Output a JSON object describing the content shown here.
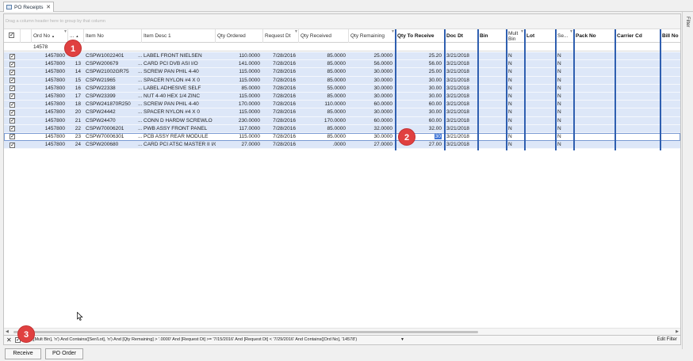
{
  "tab": {
    "label": "PO Receipts",
    "close": "✕"
  },
  "side_filter_label": "Filter",
  "group_prompt": "Drag a column header here to group by that column",
  "columns": {
    "ord_no": "Ord No",
    "line": "...",
    "item_no": "Item No",
    "item_desc": "Item Desc 1",
    "qty_ordered": "Qty Ordered",
    "request_dt": "Request Dt",
    "qty_received": "Qty Received",
    "qty_remaining": "Qty Remaining",
    "qty_to_receive": "Qty To Receive",
    "doc_dt": "Doc Dt",
    "bin": "Bin",
    "mult_bin": "Mult Bin",
    "lot": "Lot",
    "ser": "Se...",
    "pack_no": "Pack No",
    "carrier_cd": "Carrier Cd",
    "bill_no": "Bill No"
  },
  "filter_row": {
    "ord_no": "14578"
  },
  "ellipsis": "...",
  "rows": [
    {
      "checked": true,
      "ord_no": "1457800",
      "line": "",
      "item_no": "CSPW10022401",
      "item_desc": "LABEL FRONT NIELSEN",
      "qty_ordered": "110.0000",
      "request_dt": "7/28/2016",
      "qty_received": "85.0000",
      "qty_remaining": "25.0000",
      "qty_to_receive": "25.20",
      "doc_dt": "3/21/2018",
      "mult_bin": "N",
      "ser": "N"
    },
    {
      "checked": true,
      "ord_no": "1457800",
      "line": "13",
      "item_no": "CSPW200679",
      "item_desc": "CARD PCI DVB ASI I/O",
      "qty_ordered": "141.0000",
      "request_dt": "7/28/2016",
      "qty_received": "85.0000",
      "qty_remaining": "56.0000",
      "qty_to_receive": "56.00",
      "doc_dt": "3/21/2018",
      "mult_bin": "N",
      "ser": "N"
    },
    {
      "checked": true,
      "ord_no": "1457800",
      "line": "14",
      "item_no": "CSPW21002GR75",
      "item_desc": "SCREW PAN PHIL 4-40",
      "qty_ordered": "115.0000",
      "request_dt": "7/28/2016",
      "qty_received": "85.0000",
      "qty_remaining": "30.0000",
      "qty_to_receive": "25.00",
      "doc_dt": "3/21/2018",
      "mult_bin": "N",
      "ser": "N"
    },
    {
      "checked": true,
      "ord_no": "1457800",
      "line": "15",
      "item_no": "CSPW21965",
      "item_desc": "SPACER NYLON #4 X 0",
      "qty_ordered": "115.0000",
      "request_dt": "7/28/2016",
      "qty_received": "85.0000",
      "qty_remaining": "30.0000",
      "qty_to_receive": "30.00",
      "doc_dt": "3/21/2018",
      "mult_bin": "N",
      "ser": "N"
    },
    {
      "checked": true,
      "ord_no": "1457800",
      "line": "16",
      "item_no": "CSPW22338",
      "item_desc": "LABEL ADHESIVE SELF",
      "qty_ordered": "85.0000",
      "request_dt": "7/28/2016",
      "qty_received": "55.0000",
      "qty_remaining": "30.0000",
      "qty_to_receive": "30.00",
      "doc_dt": "3/21/2018",
      "mult_bin": "N",
      "ser": "N"
    },
    {
      "checked": true,
      "ord_no": "1457800",
      "line": "17",
      "item_no": "CSPW23399",
      "item_desc": "NUT 4-40 HEX 1/4 ZINC",
      "qty_ordered": "115.0000",
      "request_dt": "7/28/2016",
      "qty_received": "85.0000",
      "qty_remaining": "30.0000",
      "qty_to_receive": "30.00",
      "doc_dt": "3/21/2018",
      "mult_bin": "N",
      "ser": "N"
    },
    {
      "checked": true,
      "ord_no": "1457800",
      "line": "18",
      "item_no": "CSPW241870R250",
      "item_desc": "SCREW PAN PHIL 4-40",
      "qty_ordered": "170.0000",
      "request_dt": "7/28/2016",
      "qty_received": "110.0000",
      "qty_remaining": "60.0000",
      "qty_to_receive": "60.00",
      "doc_dt": "3/21/2018",
      "mult_bin": "N",
      "ser": "N"
    },
    {
      "checked": true,
      "ord_no": "1457800",
      "line": "20",
      "item_no": "CSPW24442",
      "item_desc": "SPACER NYLON #4 X 0",
      "qty_ordered": "115.0000",
      "request_dt": "7/28/2016",
      "qty_received": "85.0000",
      "qty_remaining": "30.0000",
      "qty_to_receive": "30.00",
      "doc_dt": "3/21/2018",
      "mult_bin": "N",
      "ser": "N"
    },
    {
      "checked": true,
      "ord_no": "1457800",
      "line": "21",
      "item_no": "CSPW24470",
      "item_desc": "CONN D HARDW SCREWLO",
      "qty_ordered": "230.0000",
      "request_dt": "7/28/2016",
      "qty_received": "170.0000",
      "qty_remaining": "60.0000",
      "qty_to_receive": "60.00",
      "doc_dt": "3/21/2018",
      "mult_bin": "N",
      "ser": "N"
    },
    {
      "checked": true,
      "ord_no": "1457800",
      "line": "22",
      "item_no": "CSPW70006201",
      "item_desc": "PWB ASSY FRONT PANEL",
      "qty_ordered": "117.0000",
      "request_dt": "7/28/2016",
      "qty_received": "85.0000",
      "qty_remaining": "32.0000",
      "qty_to_receive": "32.00",
      "doc_dt": "3/21/2018",
      "mult_bin": "N",
      "ser": "N"
    },
    {
      "checked": true,
      "ord_no": "1457800",
      "line": "23",
      "item_no": "CSPW70006301",
      "item_desc": "PCB ASSY REAR MODULE",
      "qty_ordered": "115.0000",
      "request_dt": "7/28/2016",
      "qty_received": "85.0000",
      "qty_remaining": "30.0000",
      "qty_to_receive": "30",
      "doc_dt": "3/21/2018",
      "mult_bin": "N",
      "ser": "N"
    },
    {
      "checked": true,
      "ord_no": "1457800",
      "line": "24",
      "item_no": "CSPW200680",
      "item_desc": "CARD PCI ATSC MASTER II I/O",
      "qty_ordered": "27.0000",
      "request_dt": "7/28/2016",
      "qty_received": ".0000",
      "qty_remaining": "27.0000",
      "qty_to_receive": "27.00",
      "doc_dt": "3/21/2018",
      "mult_bin": "N",
      "ser": "N"
    }
  ],
  "filter_bar": {
    "close": "✕",
    "expression": "ains([Mult Bin], 'n') And Contains([Ser/Lot], 'n') And [Qty Remaining] > '.0000' And [Request Dt] >= '7/15/2016' And [Request Dt] < '7/29/2016' And Contains([Ord No], '14578')",
    "dropdown": "▼",
    "edit_label": "Edit Filter"
  },
  "buttons": {
    "receive": "Receive",
    "po_order": "PO Order"
  },
  "callouts": [
    "1",
    "2",
    "3"
  ],
  "colors": {
    "row_selected": "#dde7f8",
    "editable_column_border": "#2f5fb0",
    "callout": "#e04040"
  }
}
